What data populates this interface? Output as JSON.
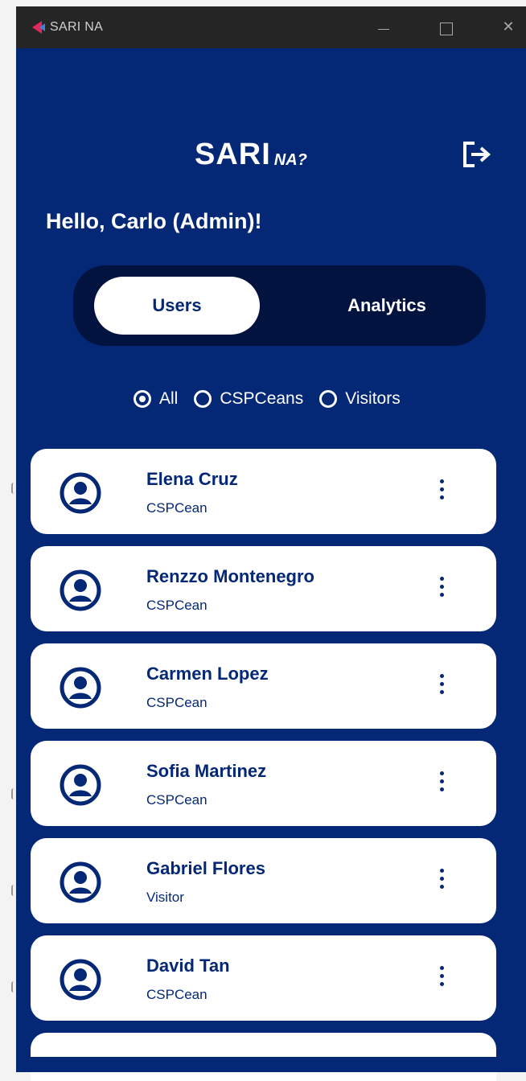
{
  "window": {
    "title": "SARI NA",
    "min_label": "—",
    "close_label": "✕"
  },
  "logo": {
    "main": "SARI",
    "sub": "NA?"
  },
  "greeting": "Hello, Carlo (Admin)!",
  "tabs": [
    {
      "label": "Users",
      "active": true
    },
    {
      "label": "Analytics",
      "active": false
    }
  ],
  "filters": [
    {
      "label": "All",
      "checked": true
    },
    {
      "label": "CSPCeans",
      "checked": false
    },
    {
      "label": "Visitors",
      "checked": false
    }
  ],
  "users": [
    {
      "name": "Elena Cruz",
      "role": "CSPCean"
    },
    {
      "name": "Renzzo Montenegro",
      "role": "CSPCean"
    },
    {
      "name": "Carmen Lopez",
      "role": "CSPCean"
    },
    {
      "name": "Sofia Martinez",
      "role": "CSPCean"
    },
    {
      "name": "Gabriel Flores",
      "role": "Visitor"
    },
    {
      "name": "David Tan",
      "role": "CSPCean"
    }
  ],
  "colors": {
    "background": "#042875",
    "tab_track": "#02133f",
    "card": "#ffffff",
    "titlebar": "#252525"
  },
  "icons": {
    "logout": "logout-icon",
    "avatar": "user-avatar-icon",
    "more": "more-vertical-icon"
  }
}
